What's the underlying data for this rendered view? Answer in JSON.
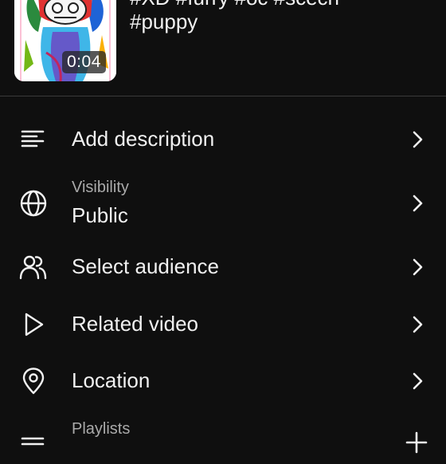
{
  "video": {
    "duration": "0:04",
    "title_line1": "#XD #furry #oc #scech",
    "title_line2": "#puppy"
  },
  "rows": {
    "description": {
      "label": "Add description",
      "icon": "text-lines-icon"
    },
    "visibility": {
      "sublabel": "Visibility",
      "label": "Public",
      "icon": "globe-icon"
    },
    "audience": {
      "label": "Select audience",
      "icon": "people-icon"
    },
    "related": {
      "label": "Related video",
      "icon": "play-icon"
    },
    "location": {
      "label": "Location",
      "icon": "location-pin-icon"
    },
    "playlists": {
      "sublabel": "Playlists",
      "icon": "playlist-icon",
      "action_icon": "plus-icon"
    }
  },
  "colors": {
    "background": "#0f0f0f",
    "text": "#f1f1f1",
    "secondary_text": "#aaaaaa",
    "divider": "#3a3a3a"
  }
}
